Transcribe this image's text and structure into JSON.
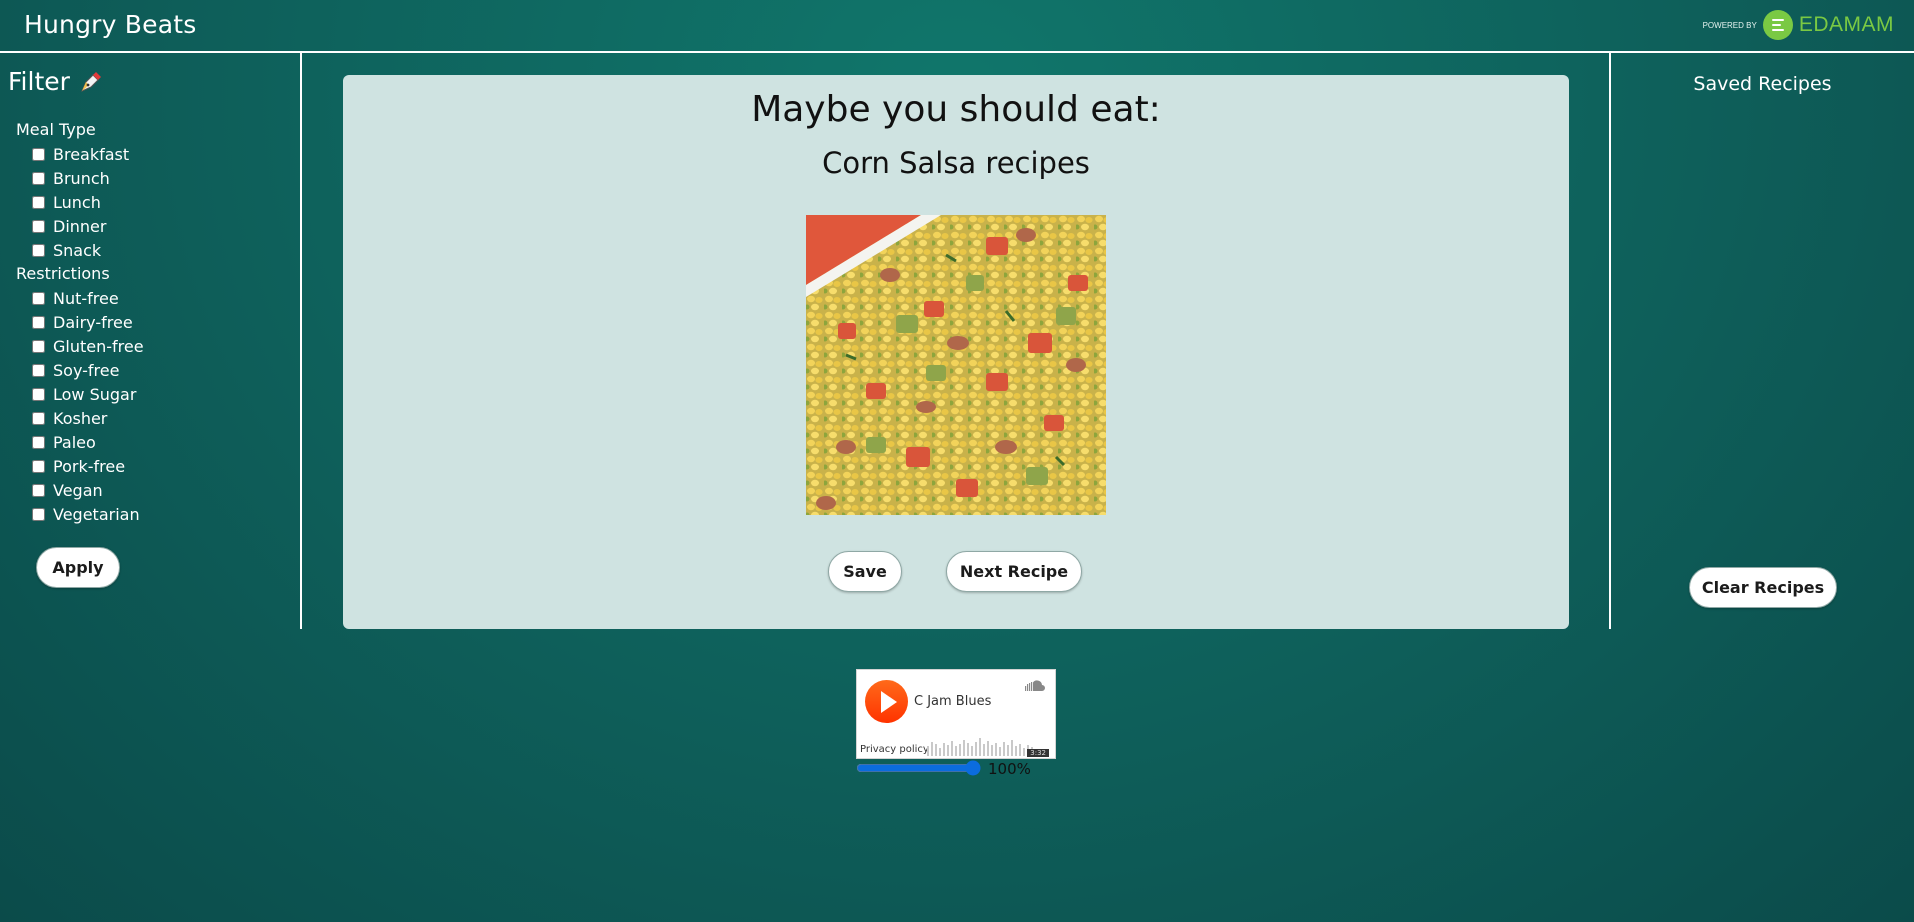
{
  "header": {
    "title": "Hungry Beats",
    "powered_by": "POWERED BY",
    "brand": "EDAMAM"
  },
  "filter": {
    "title": "Filter",
    "icon": "pen-icon",
    "meal_type_label": "Meal Type",
    "meal_types": [
      "Breakfast",
      "Brunch",
      "Lunch",
      "Dinner",
      "Snack"
    ],
    "restrictions_label": "Restrictions",
    "restrictions": [
      "Nut-free",
      "Dairy-free",
      "Gluten-free",
      "Soy-free",
      "Low Sugar",
      "Kosher",
      "Paleo",
      "Pork-free",
      "Vegan",
      "Vegetarian"
    ],
    "apply_label": "Apply"
  },
  "main": {
    "heading": "Maybe you should eat:",
    "recipe_name": "Corn Salsa recipes",
    "save_label": "Save",
    "next_label": "Next Recipe"
  },
  "saved": {
    "title": "Saved Recipes",
    "clear_label": "Clear Recipes"
  },
  "player": {
    "track": "C Jam Blues",
    "privacy": "Privacy policy",
    "duration": "3:32",
    "volume": "100%",
    "volume_value": 100
  },
  "colors": {
    "background": "#0e5f5a",
    "card": "#cfe3e1",
    "brand_green": "#7ac943",
    "play_orange": "#ff4a00"
  }
}
